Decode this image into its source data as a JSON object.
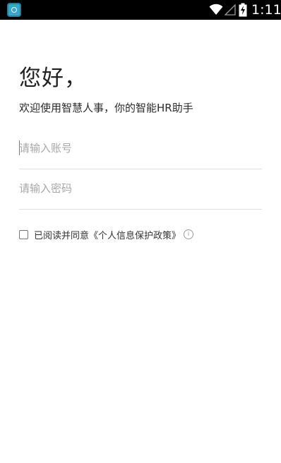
{
  "status_bar": {
    "time": "1:11",
    "icons": [
      "app-icon",
      "wifi-icon",
      "signal-icon",
      "battery-charging-icon"
    ]
  },
  "login": {
    "greeting": "您好，",
    "subtitle": "欢迎使用智慧人事，你的智能HR助手",
    "account_placeholder": "请输入账号",
    "password_placeholder": "请输入密码",
    "agree_text": "已阅读并同意",
    "policy_link": "《个人信息保护政策》",
    "info_icon_glyph": "i",
    "agreed": false
  },
  "colors": {
    "caret": "#5b7bd5",
    "divider": "#e0e0e0",
    "placeholder": "#a8a8a8"
  }
}
